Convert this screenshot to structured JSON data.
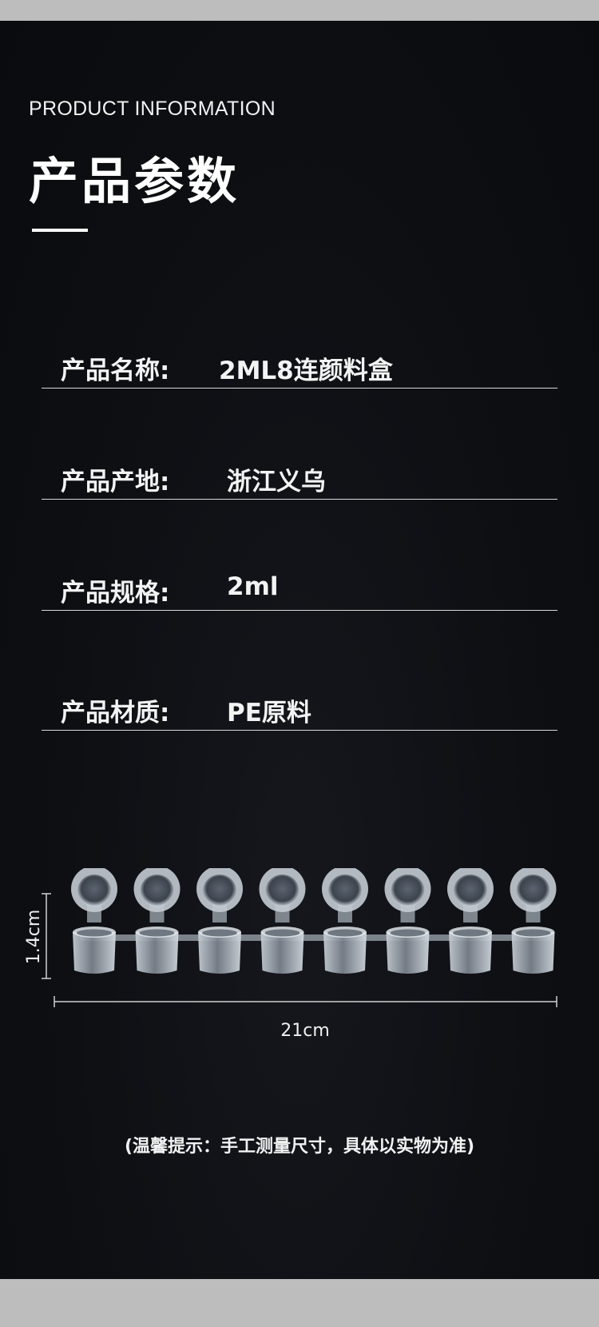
{
  "header": {
    "title_en": "PRODUCT INFORMATION",
    "title_cn": "产品参数"
  },
  "specs": [
    {
      "label": "产品名称:",
      "value": "2ML8连颜料盒"
    },
    {
      "label": "产品产地:",
      "value": "浙江义乌"
    },
    {
      "label": "产品规格:",
      "value": "2ml"
    },
    {
      "label": "产品材质:",
      "value": "PE原料"
    }
  ],
  "dimensions": {
    "height": "1.4cm",
    "width": "21cm"
  },
  "note": "(温馨提示：手工测量尺寸，具体以实物为准)",
  "colors": {
    "background": "#0d0f13",
    "text": "#ffffff",
    "page_border": "#bdbdbd"
  }
}
